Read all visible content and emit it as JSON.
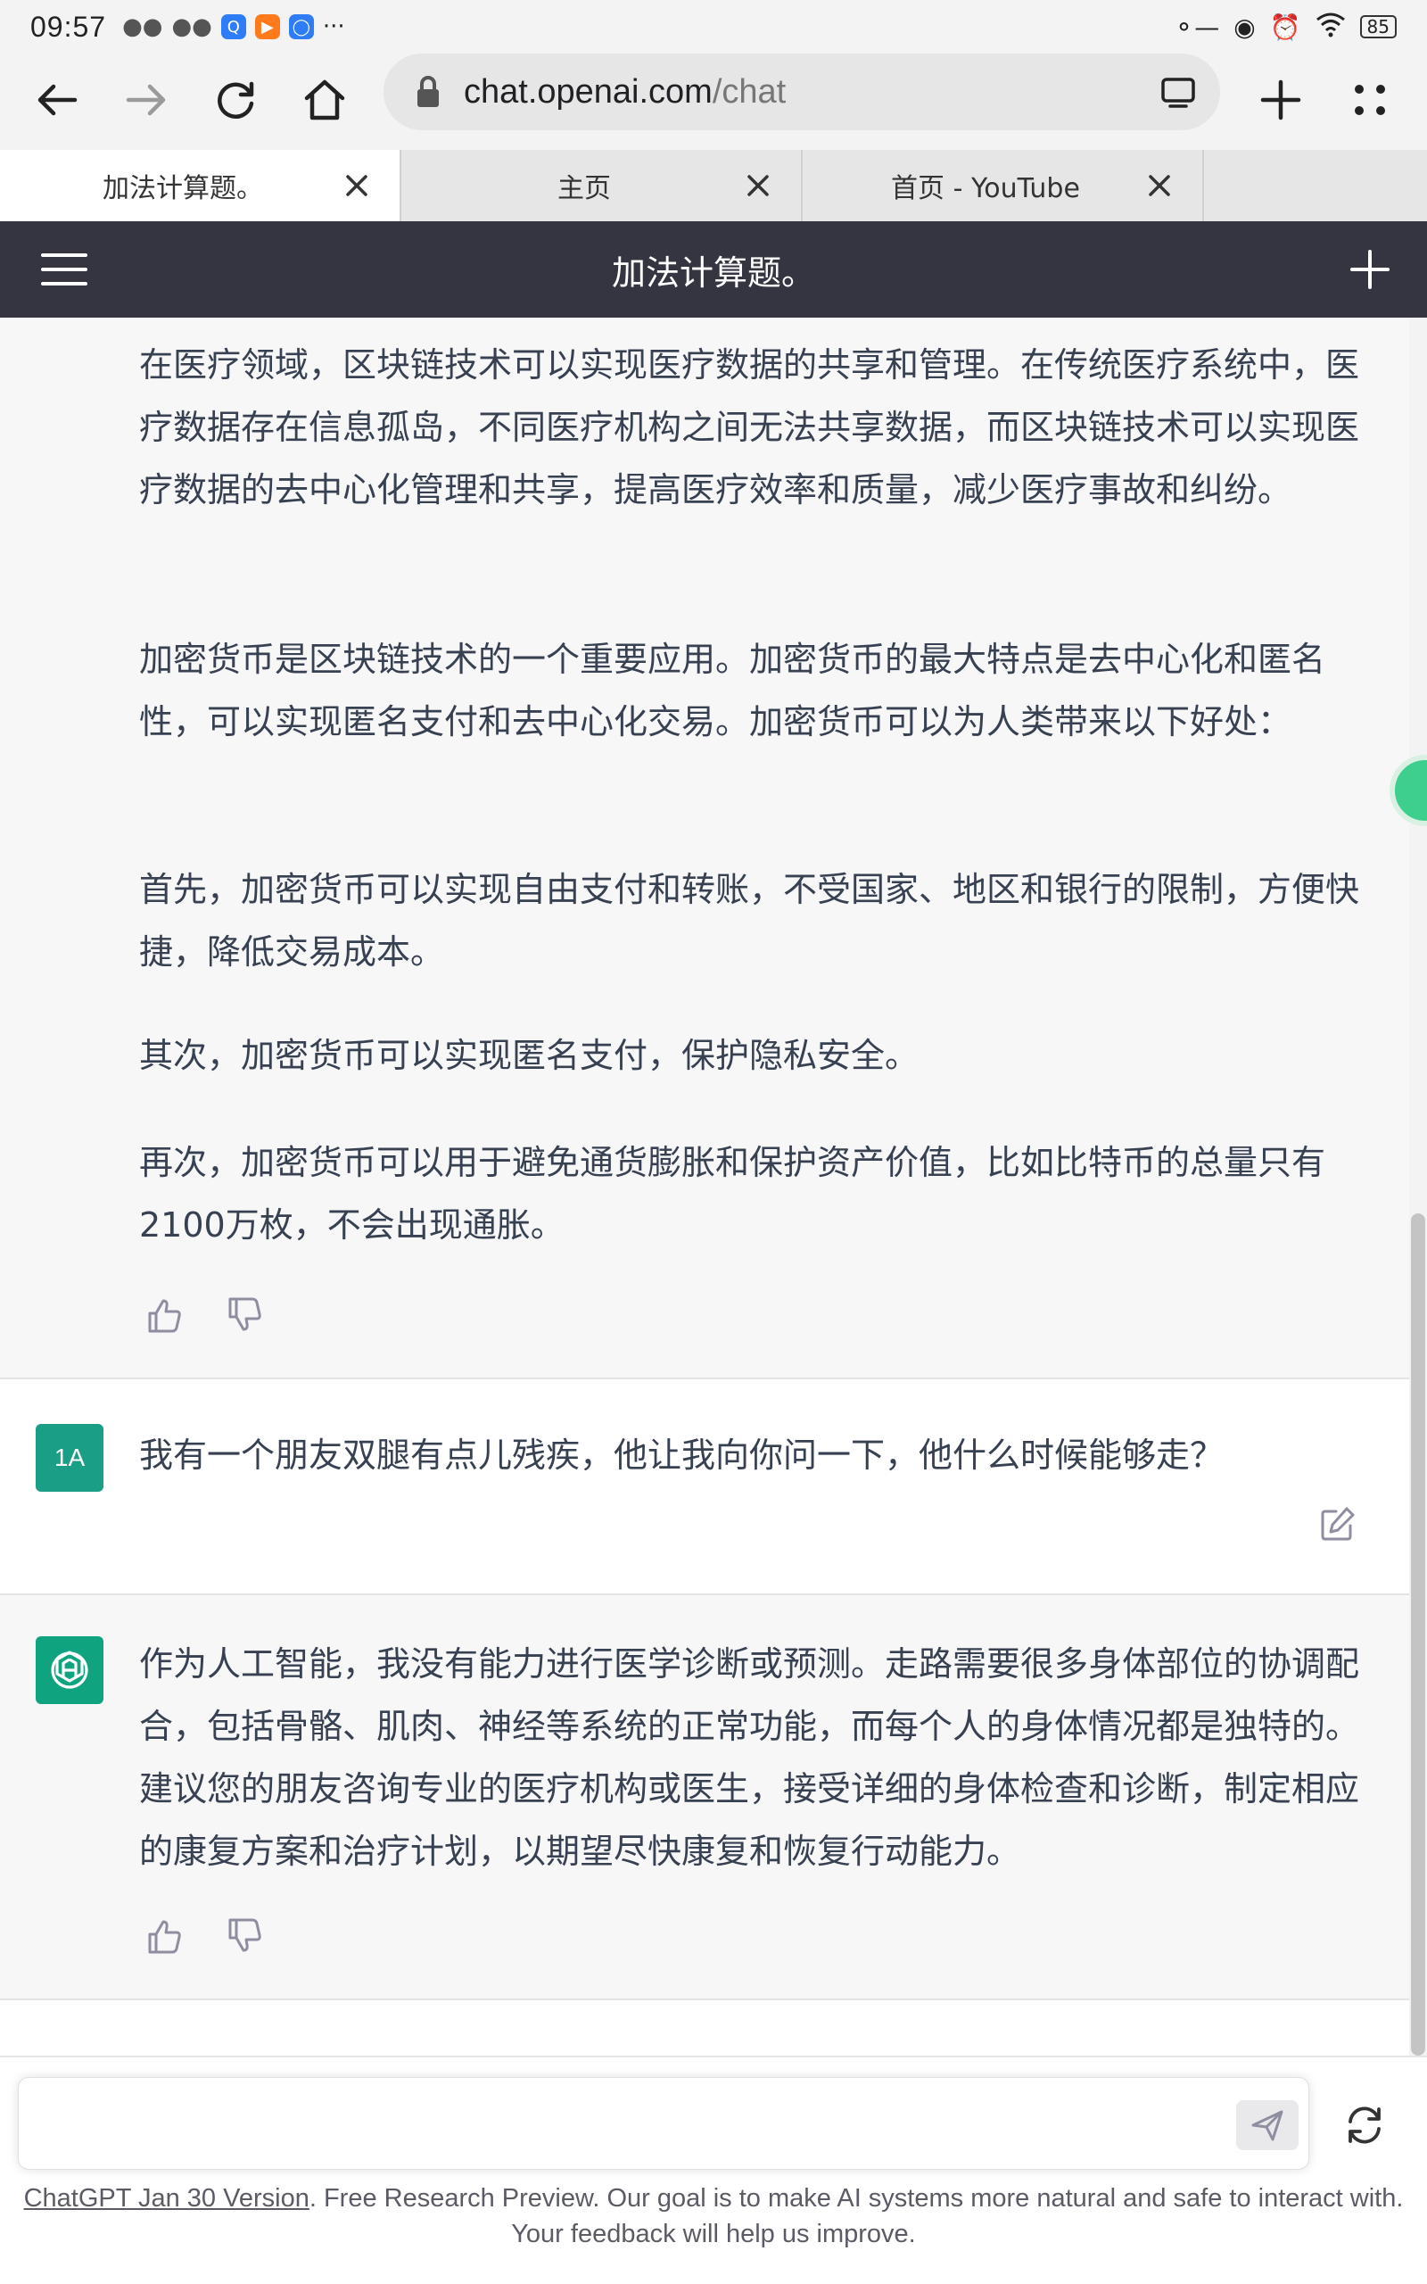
{
  "status_bar": {
    "time": "09:57",
    "dots": "···",
    "battery": "85",
    "icons": [
      "wechat-icon",
      "wechat-icon",
      "browser-app-icon",
      "video-app-icon",
      "bulb-app-icon",
      "key-icon",
      "eye-icon",
      "alarm-icon",
      "wifi-icon",
      "battery-icon"
    ]
  },
  "browser": {
    "url_host": "chat.openai.com",
    "url_path": "/chat",
    "tabs": [
      {
        "label": "加法计算题。",
        "active": true
      },
      {
        "label": "主页",
        "active": false
      },
      {
        "label": "首页 - YouTube",
        "active": false
      }
    ]
  },
  "chat": {
    "title": "加法计算题。",
    "messages": [
      {
        "role": "assistant",
        "paragraphs": [
          "在医疗领域，区块链技术可以实现医疗数据的共享和管理。在传统医疗系统中，医疗数据存在信息孤岛，不同医疗机构之间无法共享数据，而区块链技术可以实现医疗数据的去中心化管理和共享，提高医疗效率和质量，减少医疗事故和纠纷。",
          "加密货币是区块链技术的一个重要应用。加密货币的最大特点是去中心化和匿名性，可以实现匿名支付和去中心化交易。加密货币可以为人类带来以下好处：",
          "首先，加密货币可以实现自由支付和转账，不受国家、地区和银行的限制，方便快捷，降低交易成本。",
          "其次，加密货币可以实现匿名支付，保护隐私安全。",
          "再次，加密货币可以用于避免通货膨胀和保护资产价值，比如比特币的总量只有2100万枚，不会出现通胀。"
        ]
      },
      {
        "role": "user",
        "avatar_text": "1A",
        "text": "我有一个朋友双腿有点儿残疾，他让我向你问一下，他什么时候能够走？"
      },
      {
        "role": "assistant",
        "text": "作为人工智能，我没有能力进行医学诊断或预测。走路需要很多身体部位的协调配合，包括骨骼、肌肉、神经等系统的正常功能，而每个人的身体情况都是独特的。建议您的朋友咨询专业的医疗机构或医生，接受详细的身体检查和诊断，制定相应的康复方案和治疗计划，以期望尽快康复和恢复行动能力。"
      }
    ]
  },
  "composer": {
    "placeholder": ""
  },
  "footer": {
    "link": "ChatGPT Jan 30 Version",
    "text": ". Free Research Preview. Our goal is to make AI systems more natural and safe to interact with. Your feedback will help us improve."
  },
  "colors": {
    "header_bg": "#343541",
    "assistant_bg": "#f7f7f8",
    "user_avatar": "#1a9e86",
    "assistant_avatar": "#10a37f"
  }
}
